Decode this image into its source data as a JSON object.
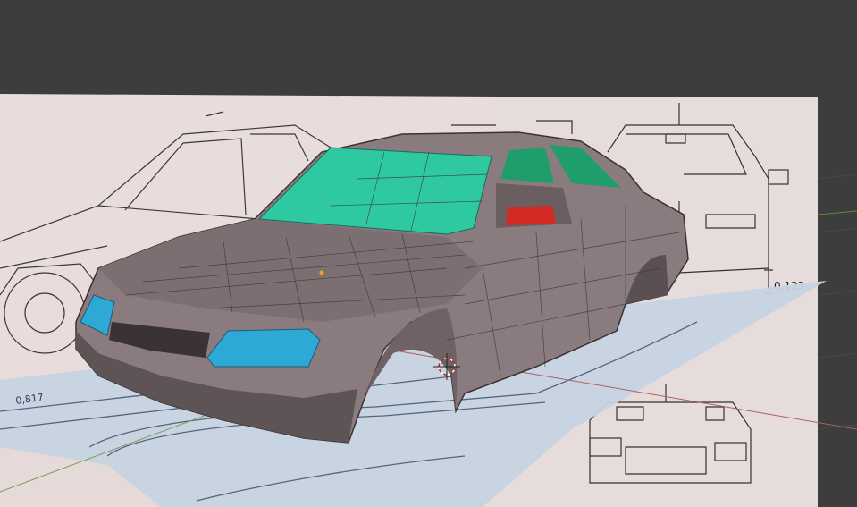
{
  "viewport": {
    "background_color": "#3d3d3d",
    "reference_plane_color": "#e9dddc",
    "floor_plane_color": "#c6d3e1",
    "car_body_color": "#8a7c7e",
    "glass_color": "#2ec9a0",
    "headlight_color": "#2ea9d6",
    "taillight_color": "#d42a24",
    "dimension_labels": {
      "side_height": "0,123",
      "floor_length": "0,817"
    }
  }
}
